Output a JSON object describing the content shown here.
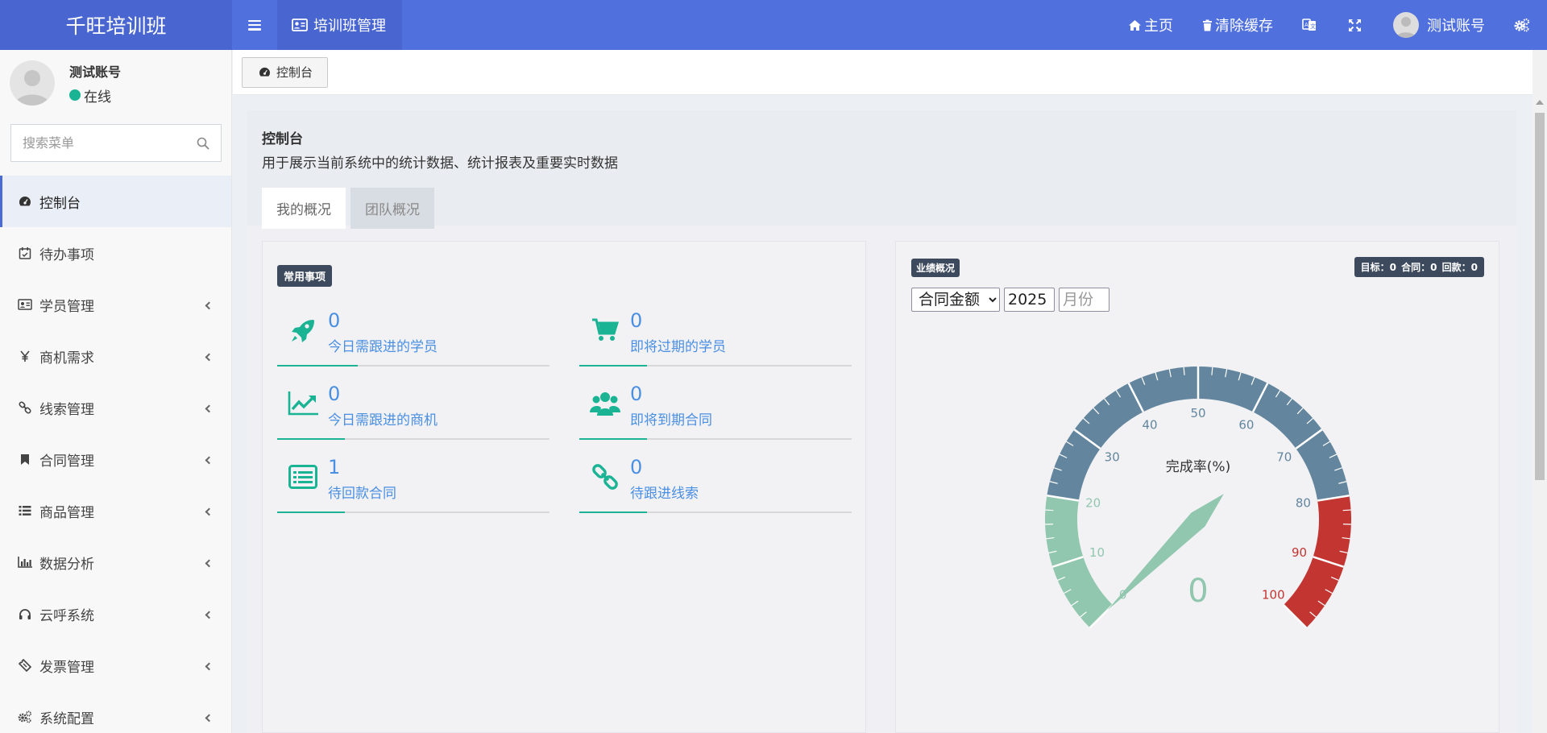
{
  "app": {
    "title": "千旺培训班"
  },
  "header": {
    "nav_tab": "培训班管理",
    "home": "主页",
    "clear_cache": "清除缓存",
    "user": "测试账号"
  },
  "sidebar": {
    "user_name": "测试账号",
    "status": "在线",
    "search_placeholder": "搜索菜单",
    "items": [
      {
        "label": "控制台",
        "icon": "dashboard-icon",
        "active": true
      },
      {
        "label": "待办事项",
        "icon": "calendar-check-icon"
      },
      {
        "label": "学员管理",
        "icon": "id-card-icon"
      },
      {
        "label": "商机需求",
        "icon": "yen-icon"
      },
      {
        "label": "线索管理",
        "icon": "link-icon"
      },
      {
        "label": "合同管理",
        "icon": "bookmark-icon"
      },
      {
        "label": "商品管理",
        "icon": "list-icon"
      },
      {
        "label": "数据分析",
        "icon": "bar-chart-icon"
      },
      {
        "label": "云呼系统",
        "icon": "headphones-icon"
      },
      {
        "label": "发票管理",
        "icon": "ticket-icon"
      },
      {
        "label": "系统配置",
        "icon": "cogs-icon"
      }
    ]
  },
  "tabs": {
    "console": "控制台"
  },
  "page": {
    "title": "控制台",
    "description": "用于展示当前系统中的统计数据、统计报表及重要实时数据",
    "pill_mine": "我的概况",
    "pill_team": "团队概况"
  },
  "common": {
    "badge": "常用事项",
    "items": [
      {
        "value": "0",
        "label": "今日需跟进的学员",
        "icon": "rocket-icon"
      },
      {
        "value": "0",
        "label": "即将过期的学员",
        "icon": "cart-icon"
      },
      {
        "value": "0",
        "label": "今日需跟进的商机",
        "icon": "trend-up-icon"
      },
      {
        "value": "0",
        "label": "即将到期合同",
        "icon": "users-icon"
      },
      {
        "value": "1",
        "label": "待回款合同",
        "icon": "list-alt-icon"
      },
      {
        "value": "0",
        "label": "待跟进线索",
        "icon": "chain-icon"
      }
    ]
  },
  "performance": {
    "badge": "业绩概况",
    "stats": "目标：0 合同：0 回款：0",
    "select_value": "合同金额",
    "year": "2025",
    "month_placeholder": "月份"
  },
  "chart_data": {
    "type": "gauge",
    "title": "完成率(%)",
    "value": 0,
    "min": 0,
    "max": 100,
    "ticks": [
      "0",
      "10",
      "20",
      "30",
      "40",
      "50",
      "60",
      "70",
      "80",
      "90",
      "100"
    ],
    "bands": [
      {
        "to": 20,
        "color": "#91c7ae"
      },
      {
        "to": 80,
        "color": "#63869e"
      },
      {
        "to": 100,
        "color": "#c23531"
      }
    ]
  },
  "colors": {
    "header": "#5070dd",
    "accent": "#1ab394",
    "link": "#4a8fe2"
  }
}
